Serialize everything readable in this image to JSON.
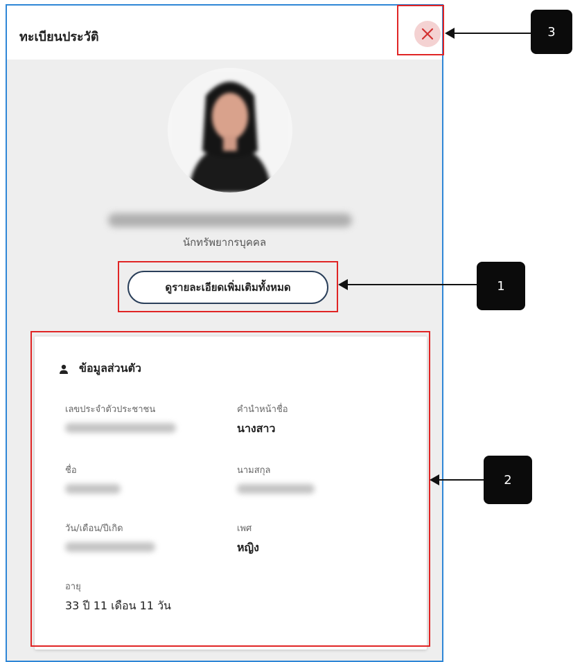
{
  "dialog": {
    "title": "ทะเบียนประวัติ",
    "position": "นักทรัพยากรบุคคล",
    "view_details_label": "ดูรายละเอียดเพิ่มเติมทั้งหมด"
  },
  "personal_section": {
    "title": "ข้อมูลส่วนตัว",
    "fields": {
      "id_label": "เลขประจำตัวประชาชน",
      "prefix_label": "คำนำหน้าชื่อ",
      "prefix_value": "นางสาว",
      "first_name_label": "ชื่อ",
      "last_name_label": "นามสกุล",
      "birth_label": "วัน/เดือน/ปีเกิด",
      "gender_label": "เพศ",
      "gender_value": "หญิง",
      "age_label": "อายุ",
      "age_value": "33 ปี 11 เดือน 11 วัน"
    }
  },
  "annotations": {
    "marker1": "1",
    "marker2": "2",
    "marker3": "3"
  },
  "colors": {
    "annotation": "#e02424",
    "panel_border": "#2e86d6",
    "close_bg": "#f4d2d2",
    "close_x": "#d32f2f"
  }
}
